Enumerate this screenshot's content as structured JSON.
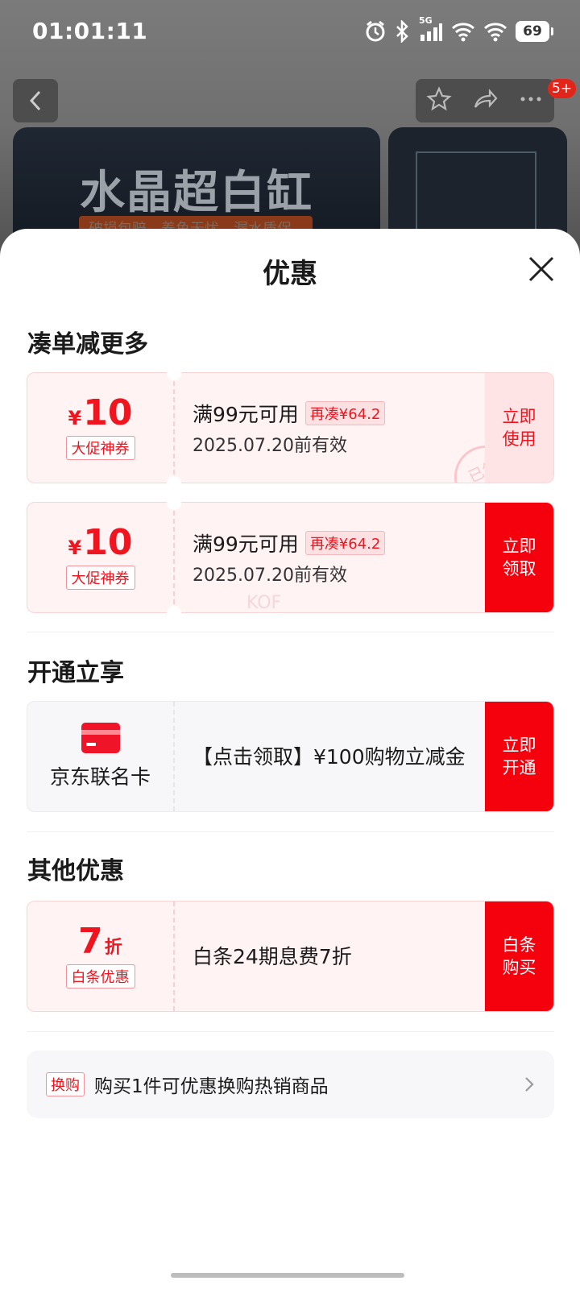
{
  "status_bar": {
    "time": "01:01:11",
    "network": "5G",
    "battery": "69"
  },
  "nav": {
    "badge": "5+"
  },
  "hero": {
    "title": "水晶超白缸",
    "tags": [
      "破损包赔",
      "养鱼无忧",
      "漏水质保"
    ]
  },
  "sheet": {
    "title": "优惠",
    "sections": {
      "more": "凑单减更多",
      "open": "开通立享",
      "other": "其他优惠"
    },
    "coupons": [
      {
        "currency": "¥",
        "amount": "10",
        "tag": "大促神券",
        "condition": "满99元可用",
        "extra": "再凑¥64.2",
        "expiry": "2025.07.20前有效",
        "button": "立即使用",
        "stamp": "已领"
      },
      {
        "currency": "¥",
        "amount": "10",
        "tag": "大促神券",
        "condition": "满99元可用",
        "extra": "再凑¥64.2",
        "expiry": "2025.07.20前有效",
        "button": "立即领取"
      }
    ],
    "card_offer": {
      "label": "京东联名卡",
      "desc": "【点击领取】¥100购物立减金",
      "button": "立即开通"
    },
    "baitiao": {
      "amount": "7",
      "unit": "折",
      "tag": "白条优惠",
      "desc": "白条24期息费7折",
      "button": "白条购买"
    },
    "trade": {
      "tag": "换购",
      "text": "购买1件可优惠换购热销商品"
    },
    "watermark": "KOF"
  },
  "colors": {
    "accent": "#f5000d",
    "soft": "#ffe4e6"
  }
}
